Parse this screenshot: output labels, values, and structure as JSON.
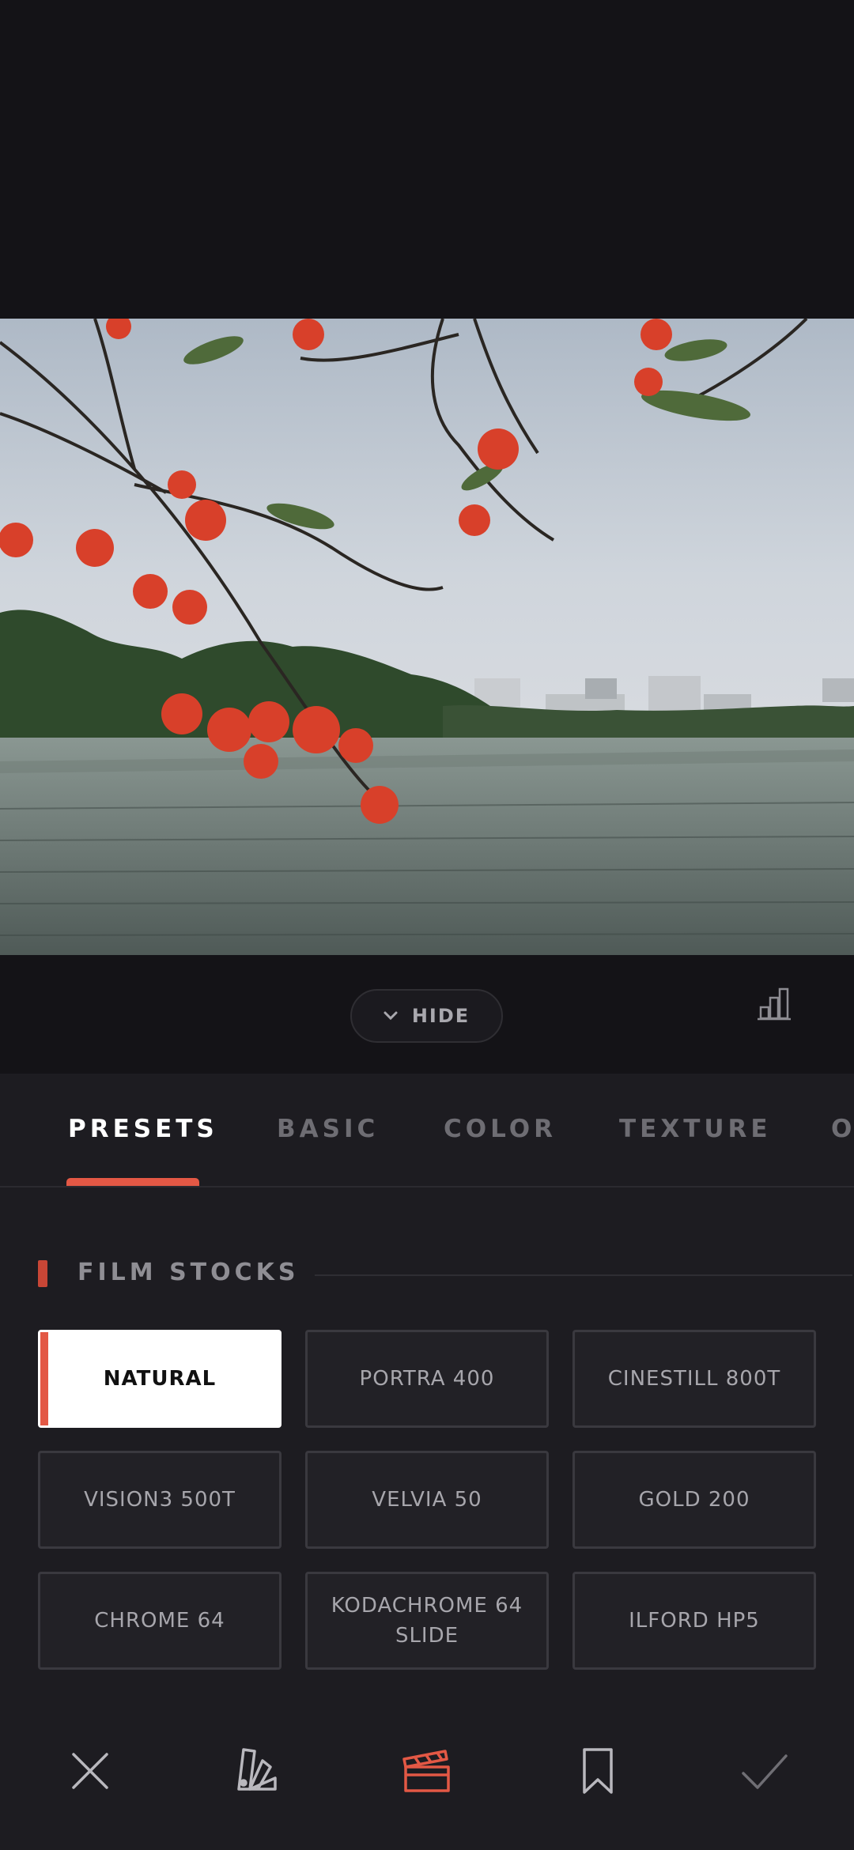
{
  "hide_bar": {
    "hide_label": "HIDE"
  },
  "tabs": [
    {
      "label": "PRESETS",
      "active": true
    },
    {
      "label": "BASIC",
      "active": false
    },
    {
      "label": "COLOR",
      "active": false
    },
    {
      "label": "TEXTURE",
      "active": false
    },
    {
      "label": "O",
      "active": false
    }
  ],
  "section": {
    "title": "FILM STOCKS"
  },
  "presets": [
    {
      "label": "NATURAL",
      "selected": true
    },
    {
      "label": "PORTRA 400",
      "selected": false
    },
    {
      "label": "CINESTILL 800T",
      "selected": false
    },
    {
      "label": "VISION3 500T",
      "selected": false
    },
    {
      "label": "VELVIA 50",
      "selected": false
    },
    {
      "label": "GOLD 200",
      "selected": false
    },
    {
      "label": "CHROME 64",
      "selected": false
    },
    {
      "label": "KODACHROME 64 SLIDE",
      "selected": false
    },
    {
      "label": "ILFORD HP5",
      "selected": false
    }
  ],
  "bottom_bar": {
    "icons": [
      "close-icon",
      "palette-swatch-icon",
      "clapperboard-icon",
      "bookmark-icon",
      "check-icon"
    ],
    "active_icon": "clapperboard-icon"
  },
  "colors": {
    "accent": "#e35845",
    "background": "#141317",
    "panel": "#1d1c21"
  }
}
